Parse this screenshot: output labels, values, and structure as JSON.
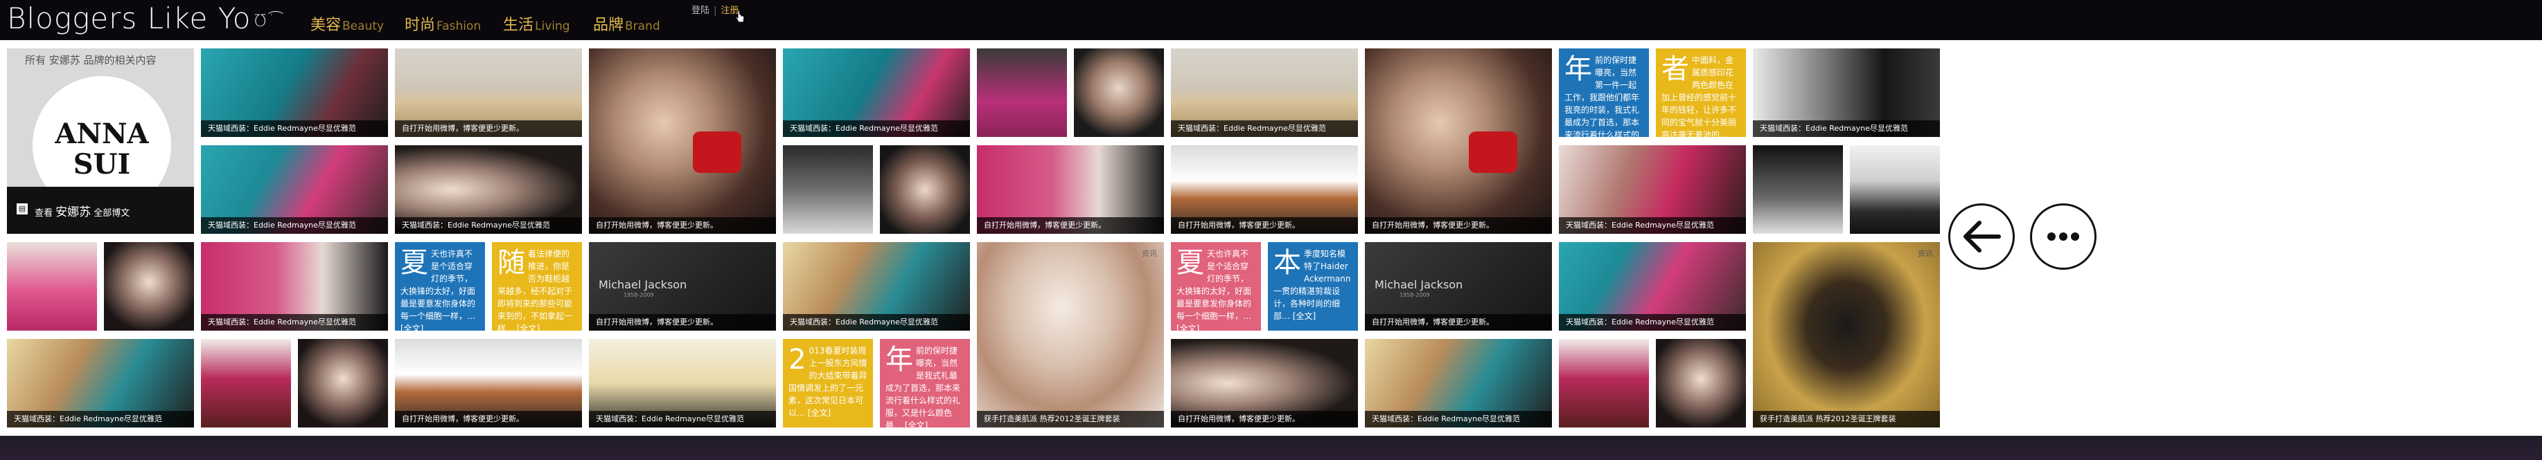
{
  "header": {
    "logo_text": "Bloggers Like Yo",
    "logo_mark": "Ʊ˙͡",
    "nav": [
      {
        "zh": "美容",
        "en": "Beauty"
      },
      {
        "zh": "时尚",
        "en": "Fashion"
      },
      {
        "zh": "生活",
        "en": "Living"
      },
      {
        "zh": "品牌",
        "en": "Brand"
      }
    ],
    "login": "登陆",
    "register": "注册"
  },
  "brand_card": {
    "title": "所有 安娜苏 品牌的相关内容",
    "logo_line1": "ANNA",
    "logo_line2": "SUI",
    "footer_prefix": "查看",
    "footer_brand": "安娜苏",
    "footer_suffix": "全部博文"
  },
  "captions": {
    "tmall": "天猫域西装：Eddie Redmayne尽显优雅范",
    "weibo": "自打开始用微博，博客便更少更新。",
    "dress": "获手打造美肌派 热荐2012圣诞王牌套装"
  },
  "text_cards": {
    "nian1": {
      "big": "年",
      "body": "前的保时捷曝亮，当然第一件一起工作，我跟他们都年我亮的时装，我式礼最成为了首选，那本来流行着什么样式的礼服，又是什么颜色最… [全文]"
    },
    "zhe": {
      "big": "者",
      "body": "中面料，金属质感印花两色颜色在加上曾经的感觉前十年的钱轻，让许多不同的宝气就十分美丽高达毫无差池的… [全文]"
    },
    "xia1": {
      "big": "夏",
      "body": "天也许真不是个适合穿灯的季节，大换锋的太好，好面最是要意发你身体的每一个细胞一样，… [全文]"
    },
    "sui": {
      "big": "随",
      "body": "着法律便的推进，你是否为鞋柜越来越多，经不起对于即将到来的那些可能来到的，不如拿起一样… [全文]"
    },
    "xia2": {
      "big": "夏",
      "body": "天也许真不是个适合穿灯的季节，大换锋的太好，好面最是要意发你身体的每一个细胞一样，… [全文]"
    },
    "ben": {
      "big": "本",
      "body": "季度知名模特了Haider Ackermann一贯的精湛剪裁设计，各种时尚的细部… [全文]"
    },
    "num2": {
      "big": "2",
      "body": "013春夏时装周上一股东方风情的大结束带着异国情调发上的了一元素，这次常见日本可以… [全文]"
    },
    "nian2": {
      "big": "年",
      "body": "前的保时捷曝亮，当然是我式礼最成为了首选，那本来流行着什么样式的礼服，又是什么颜色最… [全文]"
    }
  },
  "michael": {
    "name": "Michael Jackson",
    "sub": "1958-2009"
  },
  "overlay_tag": "资讯",
  "colors": {
    "topbar": "#0a080c",
    "accent": "#e3b84c",
    "card_blue": "#1f74b8",
    "card_yellow": "#e9b81b",
    "card_pink": "#e0627b",
    "card_dark": "#1f1f1f"
  },
  "icons": {
    "back": "arrow-left-icon",
    "more": "more-icon"
  }
}
